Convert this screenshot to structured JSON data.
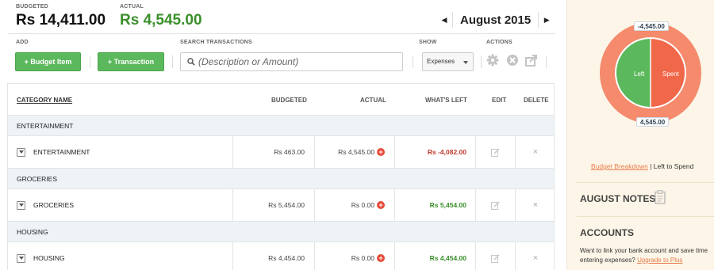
{
  "header": {
    "budgeted_label": "BUDGETED",
    "budgeted_value": "Rs 14,411.00",
    "actual_label": "ACTUAL",
    "actual_value": "Rs 4,545.00",
    "month": "August 2015"
  },
  "toolbar": {
    "add_label": "ADD",
    "search_label": "SEARCH TRANSACTIONS",
    "show_label": "SHOW",
    "actions_label": "ACTIONS",
    "budget_item_button": "+ Budget Item",
    "transaction_button": "+ Transaction",
    "search_placeholder": "(Description or Amount)",
    "show_value": "Expenses"
  },
  "table": {
    "headers": {
      "category": "CATEGORY NAME",
      "budgeted": "BUDGETED",
      "actual": "ACTUAL",
      "left": "WHAT'S LEFT",
      "edit": "EDIT",
      "delete": "DELETE"
    },
    "groups": [
      {
        "name": "ENTERTAINMENT",
        "row": {
          "name": "ENTERTAINMENT",
          "budgeted": "Rs 463.00",
          "actual": "Rs 4,545.00",
          "left": "Rs -4,082.00",
          "status": "negative"
        }
      },
      {
        "name": "GROCERIES",
        "row": {
          "name": "GROCERIES",
          "budgeted": "Rs 5,454.00",
          "actual": "Rs 0.00",
          "left": "Rs 5,454.00",
          "status": "positive"
        }
      },
      {
        "name": "HOUSING",
        "row": {
          "name": "HOUSING",
          "budgeted": "Rs 4,454.00",
          "actual": "Rs 0.00",
          "left": "Rs 4,454.00",
          "status": "positive"
        }
      }
    ]
  },
  "sidebar": {
    "pie": {
      "top_value": "-4,545.00",
      "bottom_value": "4,545.00",
      "left_label": "Left",
      "spent_label": "Spent",
      "colors": {
        "outer": "#f58a6c",
        "left": "#5cb85c",
        "spent": "#f0674a"
      }
    },
    "breakdown_link": "Budget Breakdown",
    "breakdown_sep": " | ",
    "breakdown_text": "Left to Spend",
    "notes_title": "AUGUST NOTES",
    "accounts_title": "ACCOUNTS",
    "accounts_text": "Want to link your bank account and save time entering expenses?",
    "accounts_link": "Upgrade to Plus"
  },
  "icons": {
    "prev": "chevron-left-icon",
    "next": "chevron-right-icon",
    "search": "search-icon",
    "gear": "gear-icon",
    "close": "close-circle-icon",
    "share": "share-icon",
    "notes": "clipboard-icon"
  }
}
